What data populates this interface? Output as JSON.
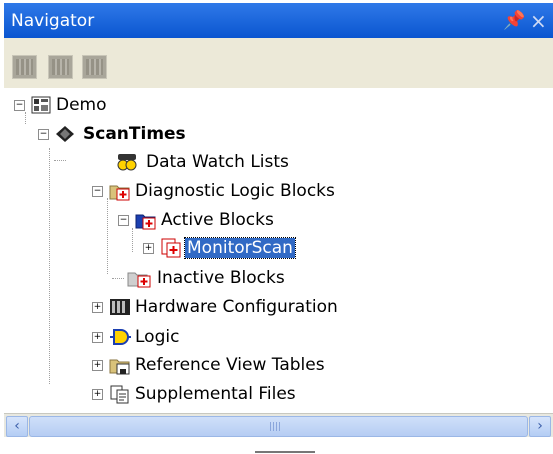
{
  "window": {
    "title": "Navigator",
    "pin_glyph": "p",
    "close_glyph": "×"
  },
  "toolbar": {
    "buttons": [
      {
        "icon": "grid-view-icon"
      },
      {
        "icon": "expand-icon"
      },
      {
        "icon": "collapse-icon"
      }
    ]
  },
  "tree": {
    "root": {
      "label": "Demo",
      "expander": "−"
    },
    "target": {
      "label": "ScanTimes",
      "expander": "−"
    },
    "items": [
      {
        "label": "Data Watch Lists"
      },
      {
        "label": "Diagnostic Logic Blocks",
        "expander": "−"
      },
      {
        "label": "Active Blocks",
        "expander": "−"
      },
      {
        "label": "MonitorScan",
        "expander": "+",
        "selected": true
      },
      {
        "label": "Inactive Blocks"
      },
      {
        "label": "Hardware Configuration",
        "expander": "+"
      },
      {
        "label": "Logic",
        "expander": "+"
      },
      {
        "label": "Reference View Tables",
        "expander": "+"
      },
      {
        "label": "Supplemental Files",
        "expander": "+"
      }
    ]
  },
  "scrollbar": {
    "left_arrow": "‹",
    "right_arrow": "›"
  },
  "colors": {
    "titlebar": "#0a55d0",
    "selection": "#316ac5",
    "toolbar_bg": "#ece9d8"
  }
}
